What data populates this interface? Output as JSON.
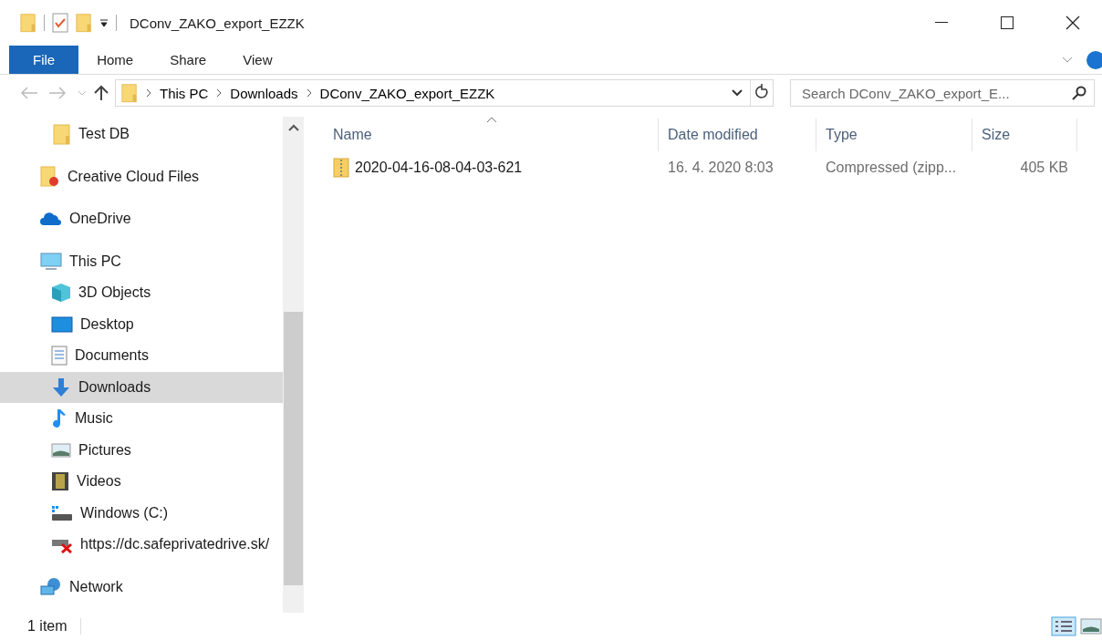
{
  "window": {
    "title": "DConv_ZAKO_export_EZZK"
  },
  "ribbon_tabs": [
    {
      "label": "File",
      "selected": true
    },
    {
      "label": "Home",
      "selected": false
    },
    {
      "label": "Share",
      "selected": false
    },
    {
      "label": "View",
      "selected": false
    }
  ],
  "address_bar": {
    "crumbs": [
      "This PC",
      "Downloads",
      "DConv_ZAKO_export_EZZK"
    ]
  },
  "search": {
    "placeholder": "Search DConv_ZAKO_export_E..."
  },
  "sidebar": {
    "partial_items": [
      {
        "label": "Test DB",
        "kind": "folder",
        "selected": false
      }
    ],
    "items": [
      {
        "label": "Creative Cloud Files",
        "kind": "cc",
        "selected": false
      },
      {
        "label": "OneDrive",
        "kind": "cloud",
        "selected": false
      },
      {
        "label": "This PC",
        "kind": "pc",
        "selected": false,
        "children": [
          {
            "label": "3D Objects",
            "kind": "cube",
            "selected": false
          },
          {
            "label": "Desktop",
            "kind": "desktop",
            "selected": false
          },
          {
            "label": "Documents",
            "kind": "document",
            "selected": false
          },
          {
            "label": "Downloads",
            "kind": "download",
            "selected": true
          },
          {
            "label": "Music",
            "kind": "music",
            "selected": false
          },
          {
            "label": "Pictures",
            "kind": "picture",
            "selected": false
          },
          {
            "label": "Videos",
            "kind": "video",
            "selected": false
          },
          {
            "label": "Windows  (C:)",
            "kind": "drive",
            "selected": false
          },
          {
            "label": "https://dc.safeprivatedrive.sk/",
            "kind": "netdrive",
            "selected": false
          }
        ]
      },
      {
        "label": "Network",
        "kind": "network",
        "selected": false
      }
    ]
  },
  "table": {
    "columns": [
      "Name",
      "Date modified",
      "Type",
      "Size"
    ],
    "rows": [
      {
        "name": "2020-04-16-08-04-03-621",
        "date": "16. 4. 2020 8:03",
        "type": "Compressed (zipp...",
        "size": "405 KB"
      }
    ]
  },
  "status_bar": {
    "count": "1 item"
  }
}
